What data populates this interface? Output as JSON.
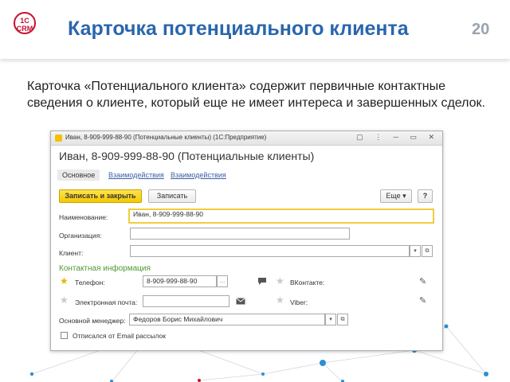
{
  "slide": {
    "title": "Карточка потенциального клиента",
    "page_number": "20",
    "logo_text_top": "1С",
    "logo_text_bottom": "CRM",
    "intro": "Карточка «Потенциального клиента» содержит первичные контактные сведения о клиенте, который еще не имеет интереса и завершенных сделок."
  },
  "window": {
    "title": "Иван, 8-909-999-88-90 (Потенциальные клиенты)  (1С:Предприятие)",
    "controls": "▢ ⋮ ─ ▭ ✕",
    "form_title": "Иван, 8-909-999-88-90 (Потенциальные клиенты)",
    "tabs": [
      "Основное",
      "Взаимодействия",
      "Взаимодействия"
    ],
    "toolbar": {
      "save_close": "Записать и закрыть",
      "save": "Записать",
      "more": "Еще ▾",
      "help": "?"
    },
    "fields": {
      "name_label": "Наименование:",
      "name_value": "Иван, 8-909-999-88-90",
      "org_label": "Организация:",
      "org_value": "",
      "client_label": "Клиент:",
      "client_value": "",
      "contact_header": "Контактная информация",
      "phone_label": "Телефон:",
      "phone_value": "8-909-999-88-90",
      "vk_label": "ВКонтакте:",
      "email_label": "Электронная почта:",
      "email_value": "",
      "viber_label": "Viber:",
      "manager_label": "Основной менеджер:",
      "manager_value": "Федоров Борис Михайлович",
      "unsubscribe_label": "Отписался от Email рассылок"
    }
  },
  "colors": {
    "title_blue": "#2a66ad",
    "accent_red": "#c8102e",
    "primary_yellow": "#f5c800",
    "section_green": "#4c9a2e",
    "dots_blue": "#2b8fd6"
  }
}
